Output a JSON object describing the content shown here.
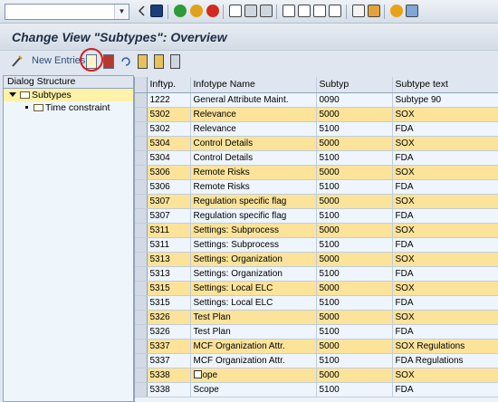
{
  "toolbar": {
    "command_value": "",
    "icons": [
      "enter-icon",
      "save-icon",
      "back-icon",
      "exit-icon",
      "cancel-icon",
      "print-icon",
      "find-icon",
      "find-next-icon",
      "first-page-icon",
      "prev-page-icon",
      "next-page-icon",
      "last-page-icon",
      "new-session-icon",
      "shortcut-icon",
      "help-icon",
      "customize-layout-icon"
    ]
  },
  "title": "Change View \"Subtypes\": Overview",
  "app_toolbar": {
    "new_entries_label": "New Entries"
  },
  "dialog": {
    "header": "Dialog Structure",
    "items": [
      {
        "label": "Subtypes"
      },
      {
        "label": "Time constraint"
      }
    ]
  },
  "table": {
    "columns": [
      "Inftyp.",
      "Infotype Name",
      "Subtyp",
      "Subtype text"
    ],
    "rows": [
      {
        "inftyp": "1222",
        "name": "General Attribute Maint.",
        "subtyp": "0090",
        "text": "Subtype 90"
      },
      {
        "inftyp": "5302",
        "name": "Relevance",
        "subtyp": "5000",
        "text": "SOX"
      },
      {
        "inftyp": "5302",
        "name": "Relevance",
        "subtyp": "5100",
        "text": "FDA"
      },
      {
        "inftyp": "5304",
        "name": "Control Details",
        "subtyp": "5000",
        "text": "SOX"
      },
      {
        "inftyp": "5304",
        "name": "Control Details",
        "subtyp": "5100",
        "text": "FDA"
      },
      {
        "inftyp": "5306",
        "name": "Remote Risks",
        "subtyp": "5000",
        "text": "SOX"
      },
      {
        "inftyp": "5306",
        "name": "Remote Risks",
        "subtyp": "5100",
        "text": "FDA"
      },
      {
        "inftyp": "5307",
        "name": "Regulation specific flag",
        "subtyp": "5000",
        "text": "SOX"
      },
      {
        "inftyp": "5307",
        "name": "Regulation specific flag",
        "subtyp": "5100",
        "text": "FDA"
      },
      {
        "inftyp": "5311",
        "name": "Settings: Subprocess",
        "subtyp": "5000",
        "text": "SOX"
      },
      {
        "inftyp": "5311",
        "name": "Settings: Subprocess",
        "subtyp": "5100",
        "text": "FDA"
      },
      {
        "inftyp": "5313",
        "name": "Settings: Organization",
        "subtyp": "5000",
        "text": "SOX"
      },
      {
        "inftyp": "5313",
        "name": "Settings: Organization",
        "subtyp": "5100",
        "text": "FDA"
      },
      {
        "inftyp": "5315",
        "name": "Settings: Local ELC",
        "subtyp": "5000",
        "text": "SOX"
      },
      {
        "inftyp": "5315",
        "name": "Settings: Local ELC",
        "subtyp": "5100",
        "text": "FDA"
      },
      {
        "inftyp": "5326",
        "name": "Test Plan",
        "subtyp": "5000",
        "text": "SOX"
      },
      {
        "inftyp": "5326",
        "name": "Test Plan",
        "subtyp": "5100",
        "text": "FDA"
      },
      {
        "inftyp": "5337",
        "name": "MCF Organization Attr.",
        "subtyp": "5000",
        "text": "SOX Regulations"
      },
      {
        "inftyp": "5337",
        "name": "MCF Organization Attr.",
        "subtyp": "5100",
        "text": "FDA Regulations"
      },
      {
        "inftyp": "5338",
        "name": "ope",
        "subtyp": "5000",
        "text": "SOX"
      },
      {
        "inftyp": "5338",
        "name": "Scope",
        "subtyp": "5100",
        "text": "FDA"
      }
    ]
  },
  "colors": {
    "highlight_row": "#fbe39a",
    "plain_row": "#eef5fd",
    "annotation_circle": "#d81c1c"
  }
}
